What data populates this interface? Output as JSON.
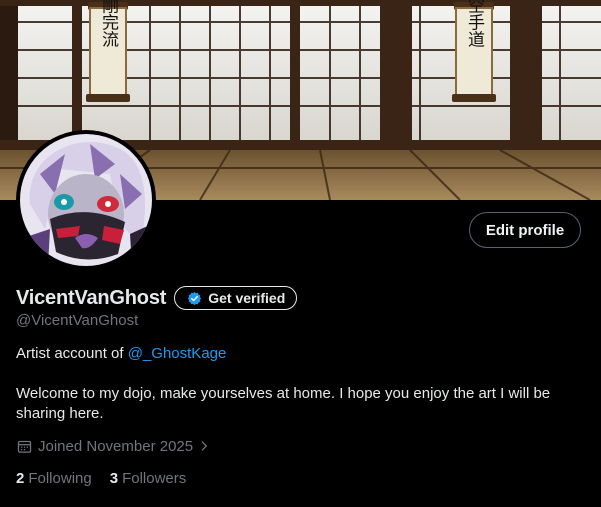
{
  "banner": {
    "scroll_left_text": "剛完流",
    "scroll_right_text": "空手道"
  },
  "profile": {
    "display_name": "VicentVanGhost",
    "handle": "@VicentVanGhost",
    "bio_line1_prefix": "Artist account of ",
    "bio_mention": "@_GhostKage",
    "bio_line2": "Welcome to my dojo, make yourselves at home. I hope you enjoy the art I will be sharing here.",
    "joined": "Joined November 2025",
    "following_count": "2",
    "following_label": "Following",
    "followers_count": "3",
    "followers_label": "Followers"
  },
  "actions": {
    "edit_profile": "Edit profile",
    "get_verified": "Get verified"
  },
  "colors": {
    "accent": "#1d9bf0",
    "muted": "#71767b",
    "background": "#000000"
  },
  "icons": {
    "verify": "verified-badge-icon",
    "calendar": "calendar-icon",
    "chevron": "chevron-right-icon"
  }
}
